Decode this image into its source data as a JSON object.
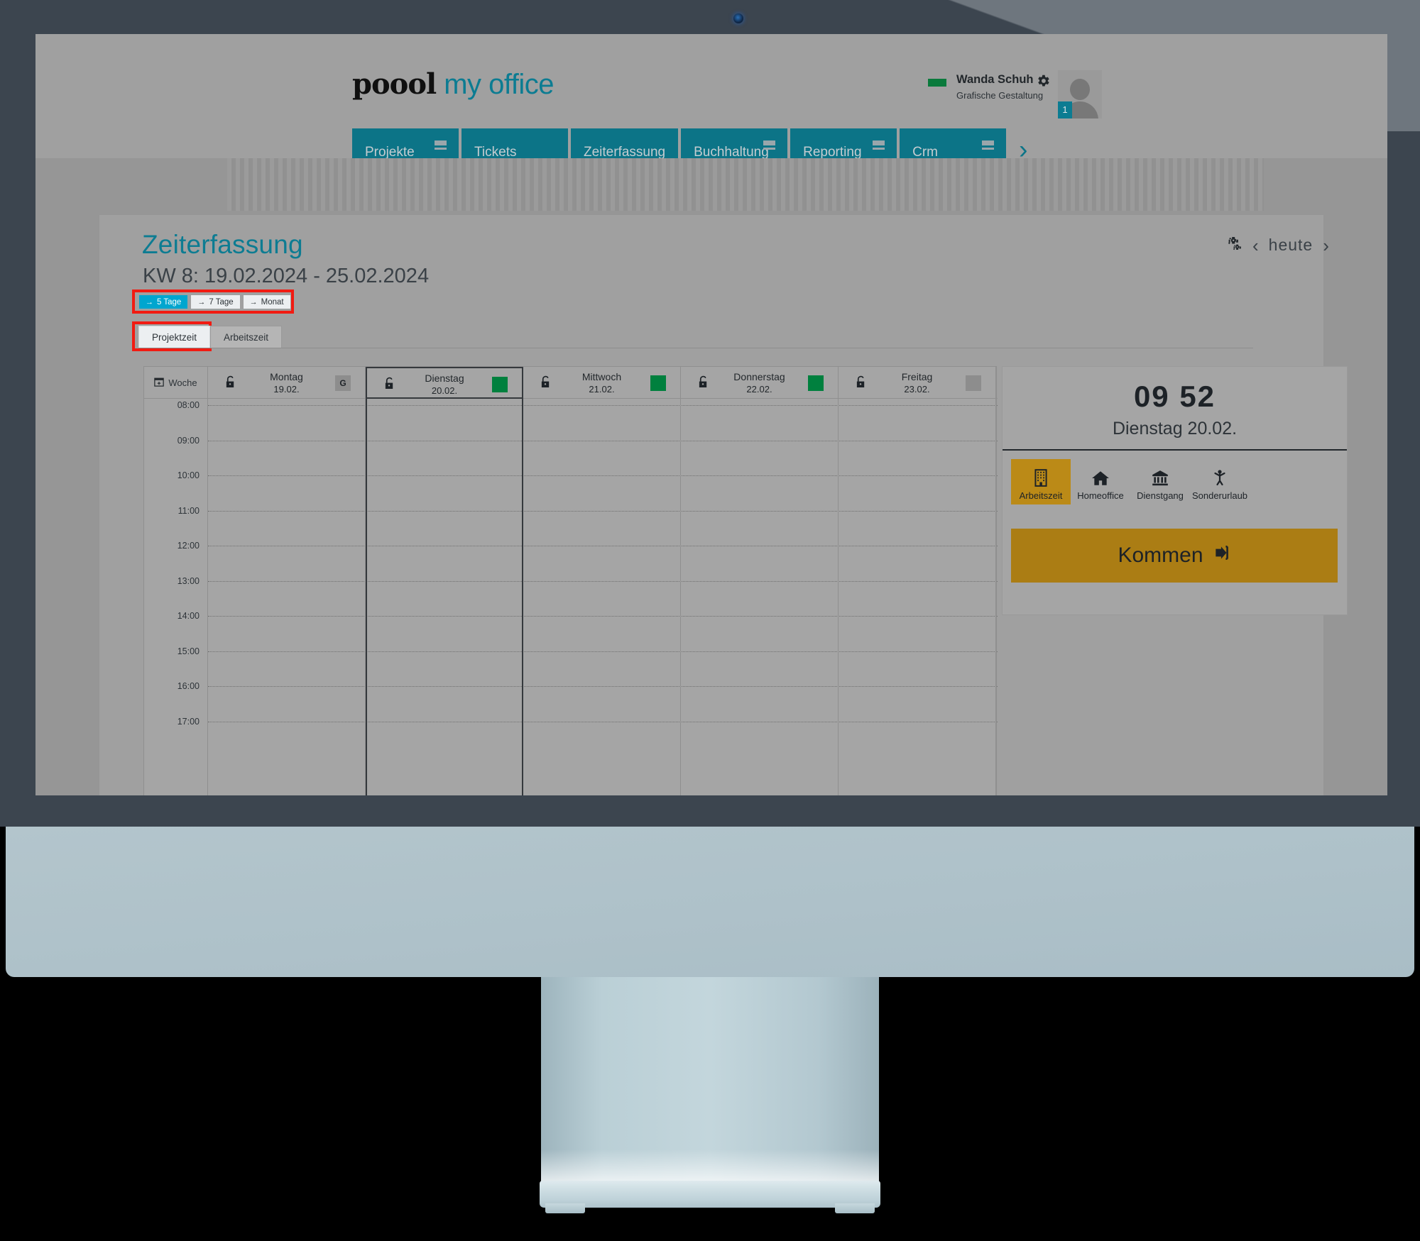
{
  "brand": {
    "logo_primary": "poool",
    "logo_secondary": "my office",
    "accent_teal": "#0c7c92",
    "accent_cyan": "#00a6cf",
    "accent_gold": "#ab7d14"
  },
  "user": {
    "name": "Wanda Schuh",
    "role": "Grafische Gestaltung",
    "badge_count": "1",
    "status_color": "#0a7a3c",
    "gear_icon": "gear-icon",
    "avatar_icon": "avatar-placeholder-icon"
  },
  "nav": {
    "items": [
      {
        "label": "Projekte",
        "has_menu": true
      },
      {
        "label": "Tickets",
        "has_menu": false
      },
      {
        "label": "Zeiterfassung",
        "has_menu": false
      },
      {
        "label": "Buchhaltung",
        "has_menu": true
      },
      {
        "label": "Reporting",
        "has_menu": true
      },
      {
        "label": "Crm",
        "has_menu": true
      }
    ],
    "more_glyph": "›"
  },
  "page": {
    "title": "Zeiterfassung",
    "subtitle": "KW 8: 19.02.2024 - 25.02.2024",
    "settings_icon": "gears-icon",
    "prev_glyph": "‹",
    "today_label": "heute",
    "next_glyph": "›"
  },
  "range_tabs": [
    {
      "label": "5 Tage",
      "arrow": "→",
      "active": true
    },
    {
      "label": "7 Tage",
      "arrow": "→",
      "active": false
    },
    {
      "label": "Monat",
      "arrow": "→",
      "active": false
    }
  ],
  "tabs": [
    {
      "label": "Projektzeit",
      "active": true
    },
    {
      "label": "Arbeitszeit",
      "active": false
    }
  ],
  "calendar": {
    "week_label": "Woche",
    "week_icon": "calendar-icon",
    "lock_icon": "unlocked-padlock-icon",
    "days": [
      {
        "name": "Montag",
        "date": "19.02.",
        "badge": "letter",
        "badge_text": "G",
        "today": false
      },
      {
        "name": "Dienstag",
        "date": "20.02.",
        "badge": "green",
        "badge_text": "",
        "today": true
      },
      {
        "name": "Mittwoch",
        "date": "21.02.",
        "badge": "green",
        "badge_text": "",
        "today": false
      },
      {
        "name": "Donnerstag",
        "date": "22.02.",
        "badge": "green",
        "badge_text": "",
        "today": false
      },
      {
        "name": "Freitag",
        "date": "23.02.",
        "badge": "gray",
        "badge_text": "",
        "today": false
      }
    ],
    "hours": [
      "08:00",
      "09:00",
      "10:00",
      "11:00",
      "12:00",
      "13:00",
      "14:00",
      "15:00",
      "16:00",
      "17:00"
    ],
    "entries": []
  },
  "side_panel": {
    "clock_time": "09 52",
    "clock_date": "Dienstag 20.02.",
    "modes": [
      {
        "label": "Arbeitszeit",
        "icon": "office-building-icon",
        "active": true
      },
      {
        "label": "Homeoffice",
        "icon": "house-icon",
        "active": false
      },
      {
        "label": "Dienstgang",
        "icon": "bank-icon",
        "active": false
      },
      {
        "label": "Sonderurlaub",
        "icon": "person-arms-up-icon",
        "active": false
      }
    ],
    "action_button": {
      "label": "Kommen",
      "icon": "sign-in-arrow-icon"
    }
  },
  "annotations": [
    {
      "name": "range-tabs-highlight",
      "color": "#f11b12"
    },
    {
      "name": "projektzeit-tab-highlight",
      "color": "#f11b12"
    }
  ]
}
